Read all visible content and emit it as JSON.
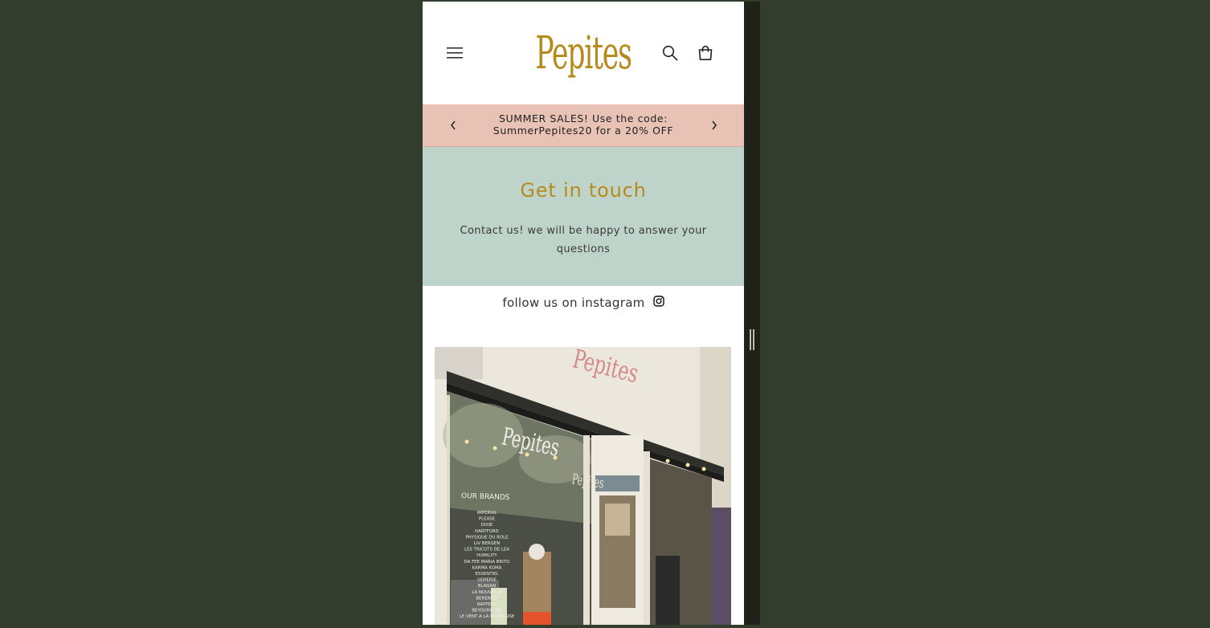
{
  "header": {
    "logo_text": "Pepites",
    "brand_color": "#b78a1c",
    "menu_icon": "hamburger-icon",
    "search_icon": "search-icon",
    "cart_icon": "cart-icon"
  },
  "announcement": {
    "line1": "SUMMER SALES! Use the code:",
    "line2": "SummerPepites20 for a 20% OFF",
    "background": "#e8c3b5"
  },
  "contact": {
    "title": "Get in touch",
    "description": "Contact us! we will be happy to answer your questions",
    "background": "#bed4cb"
  },
  "instagram": {
    "label": "follow us on instagram",
    "icon": "instagram-icon"
  },
  "storefront": {
    "sign": "Pepites",
    "window_logo": "Pepites",
    "brands_heading": "OUR BRANDS",
    "brands": [
      "IMPERIAL",
      "PLEASE",
      "DIXIE",
      "HARTFORD",
      "PHYSIQUE DU ROLE",
      "LIV BERGEN",
      "LES TRICOTS DE LEA",
      "HUMILITY",
      "DA FEE MARIA BRITO",
      "KARMA KOMA",
      "ESSENTIEL",
      "SEMERIE",
      "BLAGAN",
      "LA NOUVELLE",
      "BERENICE",
      "RAPPERS",
      "BEYOURGANE",
      "LE VENT A LA FRANCAISE"
    ]
  }
}
